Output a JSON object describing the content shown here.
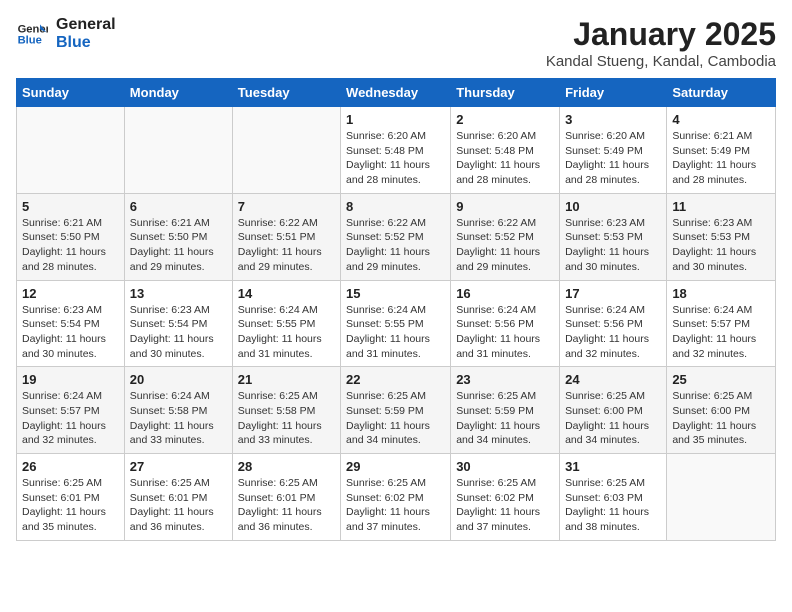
{
  "logo": {
    "line1": "General",
    "line2": "Blue"
  },
  "title": "January 2025",
  "subtitle": "Kandal Stueng, Kandal, Cambodia",
  "days_of_week": [
    "Sunday",
    "Monday",
    "Tuesday",
    "Wednesday",
    "Thursday",
    "Friday",
    "Saturday"
  ],
  "weeks": [
    [
      {
        "num": "",
        "info": ""
      },
      {
        "num": "",
        "info": ""
      },
      {
        "num": "",
        "info": ""
      },
      {
        "num": "1",
        "info": "Sunrise: 6:20 AM\nSunset: 5:48 PM\nDaylight: 11 hours and 28 minutes."
      },
      {
        "num": "2",
        "info": "Sunrise: 6:20 AM\nSunset: 5:48 PM\nDaylight: 11 hours and 28 minutes."
      },
      {
        "num": "3",
        "info": "Sunrise: 6:20 AM\nSunset: 5:49 PM\nDaylight: 11 hours and 28 minutes."
      },
      {
        "num": "4",
        "info": "Sunrise: 6:21 AM\nSunset: 5:49 PM\nDaylight: 11 hours and 28 minutes."
      }
    ],
    [
      {
        "num": "5",
        "info": "Sunrise: 6:21 AM\nSunset: 5:50 PM\nDaylight: 11 hours and 28 minutes."
      },
      {
        "num": "6",
        "info": "Sunrise: 6:21 AM\nSunset: 5:50 PM\nDaylight: 11 hours and 29 minutes."
      },
      {
        "num": "7",
        "info": "Sunrise: 6:22 AM\nSunset: 5:51 PM\nDaylight: 11 hours and 29 minutes."
      },
      {
        "num": "8",
        "info": "Sunrise: 6:22 AM\nSunset: 5:52 PM\nDaylight: 11 hours and 29 minutes."
      },
      {
        "num": "9",
        "info": "Sunrise: 6:22 AM\nSunset: 5:52 PM\nDaylight: 11 hours and 29 minutes."
      },
      {
        "num": "10",
        "info": "Sunrise: 6:23 AM\nSunset: 5:53 PM\nDaylight: 11 hours and 30 minutes."
      },
      {
        "num": "11",
        "info": "Sunrise: 6:23 AM\nSunset: 5:53 PM\nDaylight: 11 hours and 30 minutes."
      }
    ],
    [
      {
        "num": "12",
        "info": "Sunrise: 6:23 AM\nSunset: 5:54 PM\nDaylight: 11 hours and 30 minutes."
      },
      {
        "num": "13",
        "info": "Sunrise: 6:23 AM\nSunset: 5:54 PM\nDaylight: 11 hours and 30 minutes."
      },
      {
        "num": "14",
        "info": "Sunrise: 6:24 AM\nSunset: 5:55 PM\nDaylight: 11 hours and 31 minutes."
      },
      {
        "num": "15",
        "info": "Sunrise: 6:24 AM\nSunset: 5:55 PM\nDaylight: 11 hours and 31 minutes."
      },
      {
        "num": "16",
        "info": "Sunrise: 6:24 AM\nSunset: 5:56 PM\nDaylight: 11 hours and 31 minutes."
      },
      {
        "num": "17",
        "info": "Sunrise: 6:24 AM\nSunset: 5:56 PM\nDaylight: 11 hours and 32 minutes."
      },
      {
        "num": "18",
        "info": "Sunrise: 6:24 AM\nSunset: 5:57 PM\nDaylight: 11 hours and 32 minutes."
      }
    ],
    [
      {
        "num": "19",
        "info": "Sunrise: 6:24 AM\nSunset: 5:57 PM\nDaylight: 11 hours and 32 minutes."
      },
      {
        "num": "20",
        "info": "Sunrise: 6:24 AM\nSunset: 5:58 PM\nDaylight: 11 hours and 33 minutes."
      },
      {
        "num": "21",
        "info": "Sunrise: 6:25 AM\nSunset: 5:58 PM\nDaylight: 11 hours and 33 minutes."
      },
      {
        "num": "22",
        "info": "Sunrise: 6:25 AM\nSunset: 5:59 PM\nDaylight: 11 hours and 34 minutes."
      },
      {
        "num": "23",
        "info": "Sunrise: 6:25 AM\nSunset: 5:59 PM\nDaylight: 11 hours and 34 minutes."
      },
      {
        "num": "24",
        "info": "Sunrise: 6:25 AM\nSunset: 6:00 PM\nDaylight: 11 hours and 34 minutes."
      },
      {
        "num": "25",
        "info": "Sunrise: 6:25 AM\nSunset: 6:00 PM\nDaylight: 11 hours and 35 minutes."
      }
    ],
    [
      {
        "num": "26",
        "info": "Sunrise: 6:25 AM\nSunset: 6:01 PM\nDaylight: 11 hours and 35 minutes."
      },
      {
        "num": "27",
        "info": "Sunrise: 6:25 AM\nSunset: 6:01 PM\nDaylight: 11 hours and 36 minutes."
      },
      {
        "num": "28",
        "info": "Sunrise: 6:25 AM\nSunset: 6:01 PM\nDaylight: 11 hours and 36 minutes."
      },
      {
        "num": "29",
        "info": "Sunrise: 6:25 AM\nSunset: 6:02 PM\nDaylight: 11 hours and 37 minutes."
      },
      {
        "num": "30",
        "info": "Sunrise: 6:25 AM\nSunset: 6:02 PM\nDaylight: 11 hours and 37 minutes."
      },
      {
        "num": "31",
        "info": "Sunrise: 6:25 AM\nSunset: 6:03 PM\nDaylight: 11 hours and 38 minutes."
      },
      {
        "num": "",
        "info": ""
      }
    ]
  ]
}
